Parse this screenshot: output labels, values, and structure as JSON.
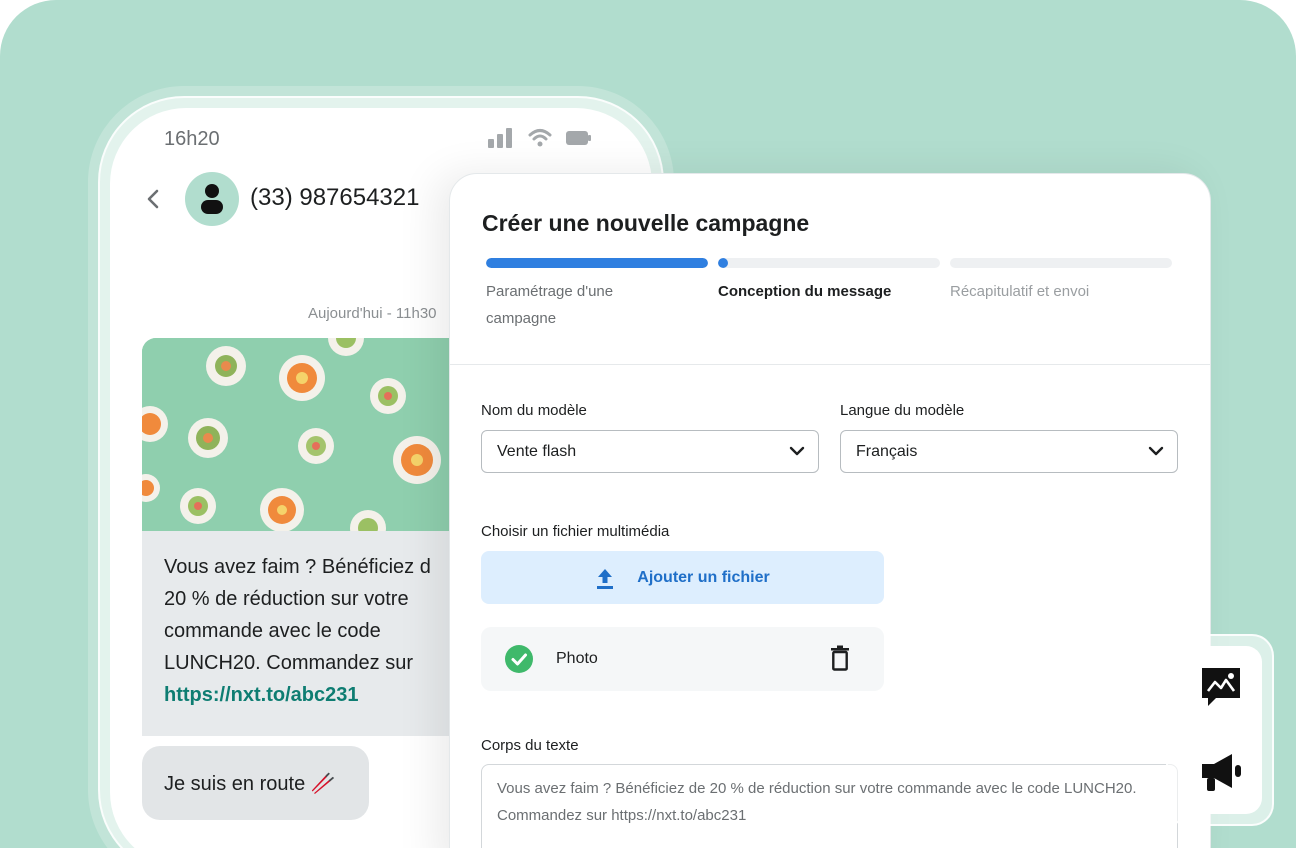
{
  "phone": {
    "time": "16h20",
    "contact": "(33) 987654321",
    "date_label": "Aujourd'hui - 11h30",
    "message_lines": [
      "Vous avez faim ? Bénéficiez d",
      "20 % de réduction sur votre",
      "commande avec le code",
      "LUNCH20. Commandez sur"
    ],
    "message_link": "https://nxt.to/abc231",
    "reply": "Je suis en route 🥢"
  },
  "panel": {
    "title": "Créer une nouvelle campagne",
    "steps": [
      {
        "label": "Paramétrage d'une campagne",
        "progress": 1.0,
        "state": "done"
      },
      {
        "label": "Conception du message",
        "progress": 0.05,
        "state": "active"
      },
      {
        "label": "Récapitulatif et envoi",
        "progress": 0.0,
        "state": "future"
      }
    ],
    "template_name": {
      "label": "Nom du modèle",
      "value": "Vente flash"
    },
    "template_lang": {
      "label": "Langue du modèle",
      "value": "Français"
    },
    "media": {
      "label": "Choisir un fichier multimédia",
      "upload_label": "Ajouter un fichier",
      "file_name": "Photo"
    },
    "body": {
      "label": "Corps du texte",
      "value": "Vous avez faim ? Bénéficiez de 20 % de réduction sur votre commande avec le code LUNCH20. Commandez sur https://nxt.to/abc231"
    }
  },
  "colors": {
    "background": "#b1ddce",
    "accent": "#2f7fe0",
    "success": "#3fb96b",
    "link": "#0e7d72"
  },
  "icons": [
    "signal-icon",
    "wifi-icon",
    "battery-icon",
    "back-chevron-icon",
    "user-icon",
    "chevron-down-icon",
    "upload-icon",
    "check-icon",
    "trash-icon",
    "image-message-icon",
    "megaphone-icon"
  ]
}
